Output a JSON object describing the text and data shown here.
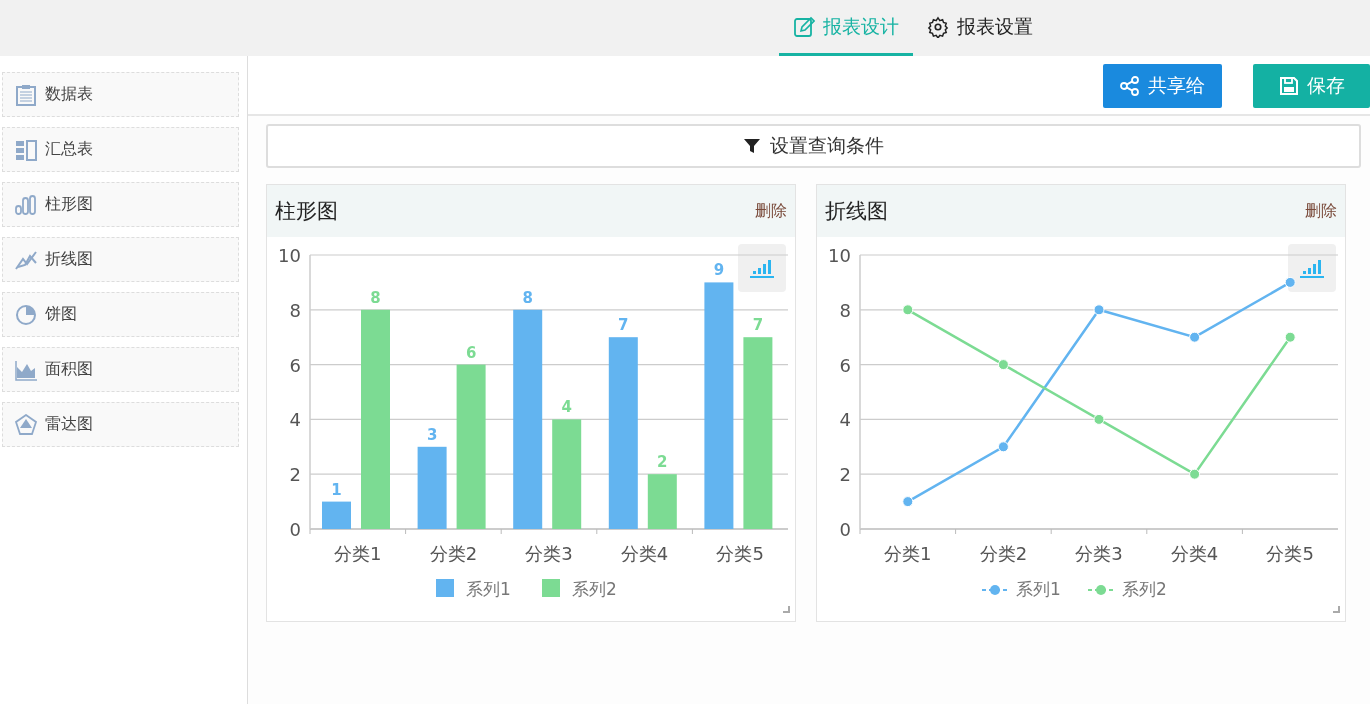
{
  "tabs": [
    {
      "label": "报表设计",
      "selected": true
    },
    {
      "label": "报表设置",
      "selected": false
    }
  ],
  "sidebar": {
    "items": [
      {
        "label": "数据表"
      },
      {
        "label": "汇总表"
      },
      {
        "label": "柱形图"
      },
      {
        "label": "折线图"
      },
      {
        "label": "饼图"
      },
      {
        "label": "面积图"
      },
      {
        "label": "雷达图"
      }
    ]
  },
  "toolbar": {
    "buttons": [
      {
        "label": "共享给",
        "kind": "share"
      },
      {
        "label": "保存",
        "kind": "save"
      }
    ]
  },
  "query_bar": {
    "label": "设置查询条件"
  },
  "panels": [
    {
      "title": "柱形图",
      "delete": "删除",
      "chart_data": {
        "type": "bar",
        "categories": [
          "分类1",
          "分类2",
          "分类3",
          "分类4",
          "分类5"
        ],
        "series": [
          {
            "name": "系列1",
            "color": "#62b4f0",
            "values": [
              1,
              3,
              8,
              7,
              9
            ]
          },
          {
            "name": "系列2",
            "color": "#7cdb93",
            "values": [
              8,
              6,
              4,
              2,
              7
            ]
          }
        ],
        "ylim": [
          0,
          10
        ],
        "yticks": [
          0,
          2,
          4,
          6,
          8,
          10
        ],
        "data_labels": true,
        "grid": true,
        "legend": true
      }
    },
    {
      "title": "折线图",
      "delete": "删除",
      "chart_data": {
        "type": "line",
        "categories": [
          "分类1",
          "分类2",
          "分类3",
          "分类4",
          "分类5"
        ],
        "series": [
          {
            "name": "系列1",
            "color": "#62b4f0",
            "values": [
              1,
              3,
              8,
              7,
              9
            ],
            "marker": "circle"
          },
          {
            "name": "系列2",
            "color": "#7cdb93",
            "values": [
              8,
              6,
              4,
              2,
              7
            ],
            "marker": "circle"
          }
        ],
        "ylim": [
          0,
          10
        ],
        "yticks": [
          0,
          2,
          4,
          6,
          8,
          10
        ],
        "grid": true,
        "legend": true
      }
    }
  ]
}
